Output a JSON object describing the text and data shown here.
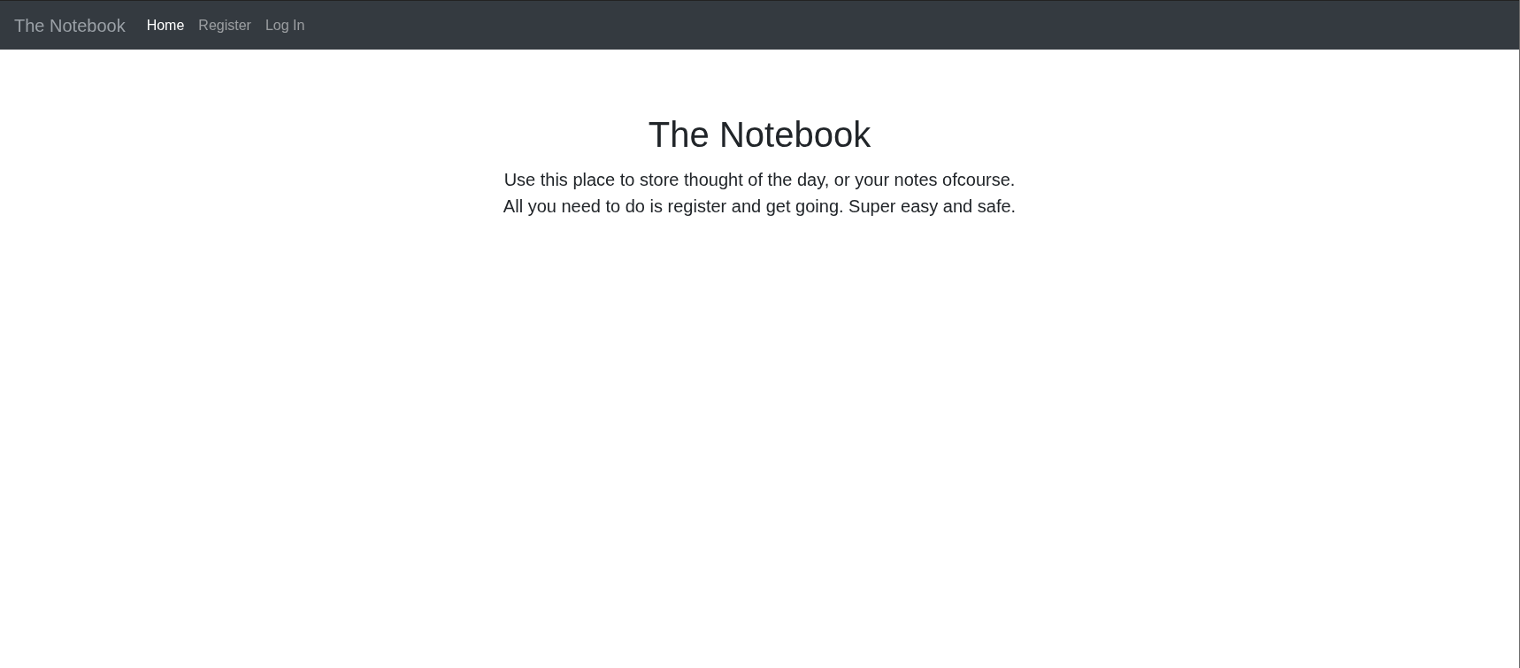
{
  "navbar": {
    "brand": "The Notebook",
    "links": [
      {
        "label": "Home",
        "selected": true
      },
      {
        "label": "Register",
        "selected": false
      },
      {
        "label": "Log In",
        "selected": false
      }
    ]
  },
  "hero": {
    "title": "The Notebook",
    "lines": [
      "Use this place to store thought of the day, or your notes ofcourse.",
      "All you need to do is register and get going. Super easy and safe."
    ]
  }
}
